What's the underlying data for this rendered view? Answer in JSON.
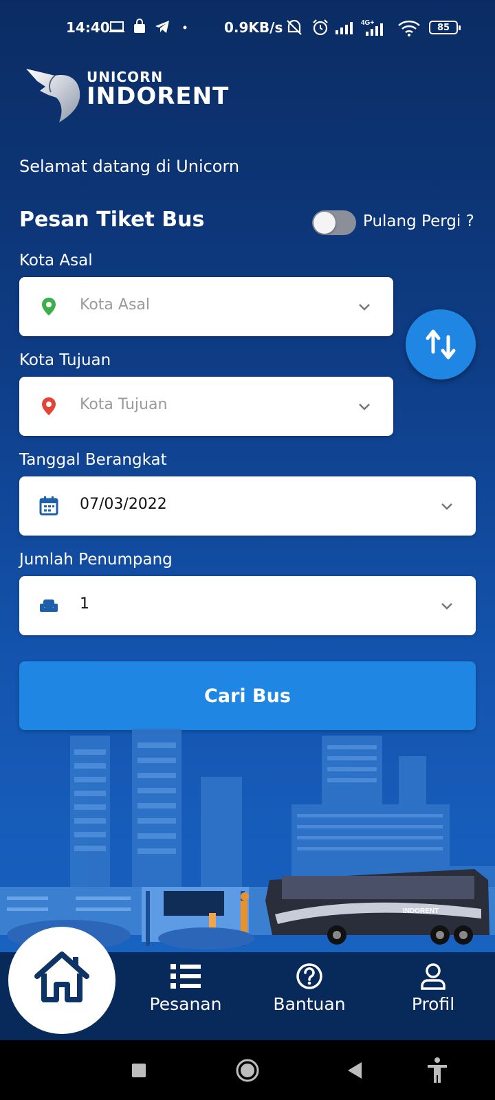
{
  "status_bar": {
    "time": "14:40",
    "network_speed": "0.9KB/s",
    "battery": "85",
    "icons": [
      "laptop-icon",
      "shopping-bag-icon",
      "telegram-icon",
      "dot-icon",
      "mute-icon",
      "alarm-icon",
      "signal-icon",
      "signal-4g-icon",
      "wifi-icon",
      "battery-icon"
    ]
  },
  "logo": {
    "brand_top": "UNICORN",
    "brand_main": "INDORENT"
  },
  "welcome_text": "Selamat datang di Unicorn",
  "form": {
    "title": "Pesan Tiket Bus",
    "round_trip_label": "Pulang Pergi ?",
    "round_trip_enabled": false,
    "origin": {
      "label": "Kota Asal",
      "placeholder": "Kota Asal",
      "icon": "map-pin-green-icon"
    },
    "destination": {
      "label": "Kota Tujuan",
      "placeholder": "Kota Tujuan",
      "icon": "map-pin-red-icon"
    },
    "departure_date": {
      "label": "Tanggal Berangkat",
      "value": "07/03/2022",
      "icon": "calendar-icon"
    },
    "passengers": {
      "label": "Jumlah Penumpang",
      "value": "1",
      "icon": "seat-icon"
    },
    "swap_icon": "swap-arrows-icon",
    "search_label": "Cari Bus"
  },
  "illustration": {
    "bus_brand": "INDORENT"
  },
  "nav": {
    "items": [
      {
        "label": "",
        "icon": "home-icon"
      },
      {
        "label": "Pesanan",
        "icon": "list-icon"
      },
      {
        "label": "Bantuan",
        "icon": "help-icon"
      },
      {
        "label": "Profil",
        "icon": "user-icon"
      }
    ]
  },
  "colors": {
    "background_top": "#0b2c63",
    "background_bottom": "#1a66c6",
    "accent": "#1f86e3",
    "nav_background": "#082a5a"
  }
}
